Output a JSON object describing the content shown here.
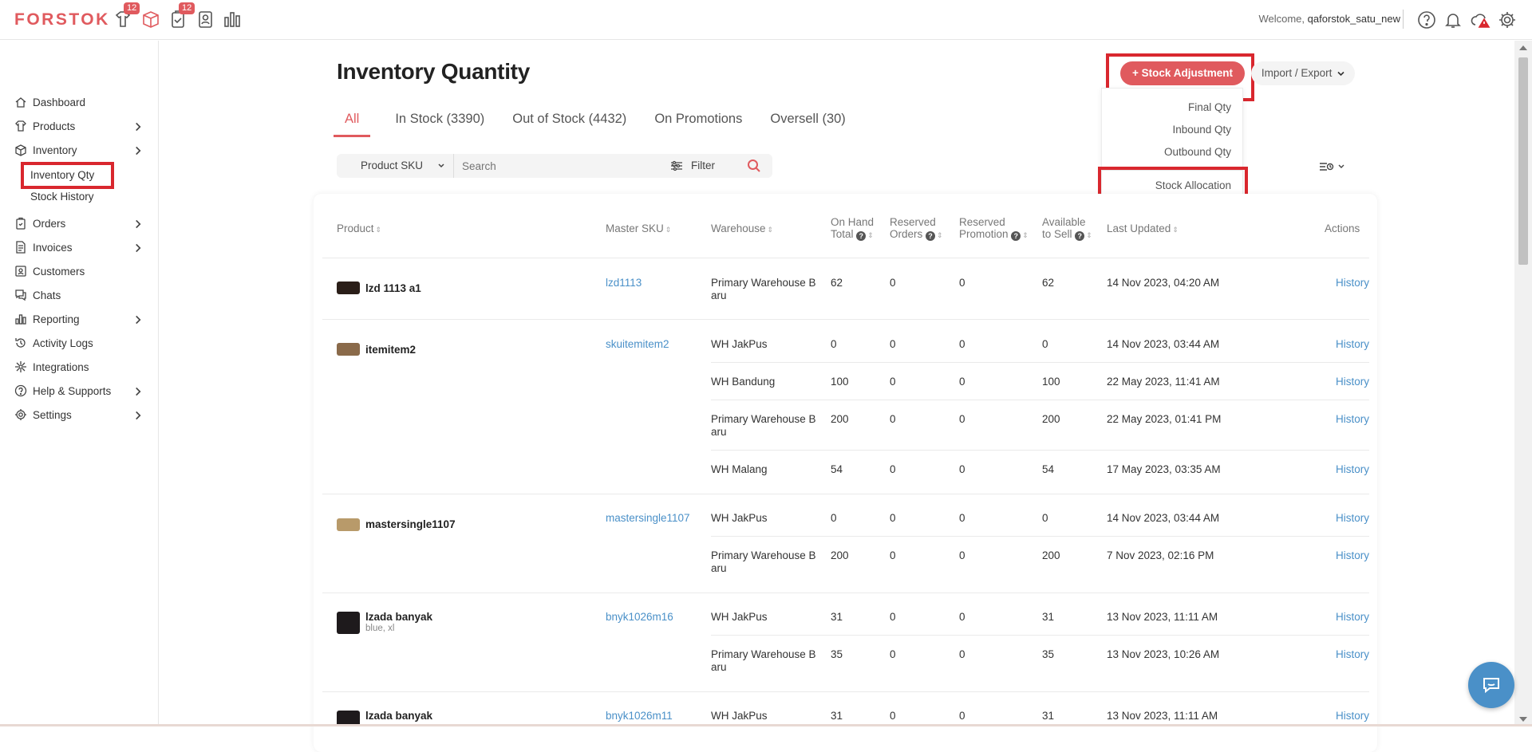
{
  "header": {
    "logo": "FORSTOK",
    "badges": [
      "12",
      "12"
    ],
    "welcome_prefix": "Welcome,",
    "username": "qaforstok_satu_new"
  },
  "sidebar": {
    "items": [
      {
        "label": "Dashboard",
        "icon": "home-icon",
        "has_children": false
      },
      {
        "label": "Products",
        "icon": "tshirt-icon",
        "has_children": true
      },
      {
        "label": "Inventory",
        "icon": "box-icon",
        "has_children": true
      },
      {
        "label": "Orders",
        "icon": "clipboard-icon",
        "has_children": true
      },
      {
        "label": "Invoices",
        "icon": "invoice-icon",
        "has_children": true
      },
      {
        "label": "Customers",
        "icon": "contact-icon",
        "has_children": false
      },
      {
        "label": "Chats",
        "icon": "chat-icon",
        "has_children": false
      },
      {
        "label": "Reporting",
        "icon": "bar-chart-icon",
        "has_children": true
      },
      {
        "label": "Activity Logs",
        "icon": "history-icon",
        "has_children": false
      },
      {
        "label": "Integrations",
        "icon": "integration-icon",
        "has_children": false
      },
      {
        "label": "Help & Supports",
        "icon": "help-icon",
        "has_children": true
      },
      {
        "label": "Settings",
        "icon": "gear-icon",
        "has_children": true
      }
    ],
    "inventory_sub": [
      "Inventory Qty",
      "Stock History"
    ]
  },
  "page": {
    "title": "Inventory Quantity",
    "stock_adjustment_label": "+ Stock Adjustment",
    "import_export_label": "Import / Export",
    "dropdown": [
      "Final Qty",
      "Inbound Qty",
      "Outbound Qty",
      "Stock Allocation"
    ],
    "tabs": [
      "All",
      "In Stock (3390)",
      "Out of Stock (4432)",
      "On Promotions",
      "Oversell (30)"
    ],
    "sku_select": "Product SKU",
    "search_placeholder": "Search",
    "filter_label": "Filter"
  },
  "table": {
    "headers": {
      "product": "Product",
      "master_sku": "Master SKU",
      "warehouse": "Warehouse",
      "on_hand_1": "On Hand",
      "on_hand_2": "Total",
      "reserved_orders_1": "Reserved",
      "reserved_orders_2": "Orders",
      "reserved_promo_1": "Reserved",
      "reserved_promo_2": "Promotion",
      "available_1": "Available",
      "available_2": "to Sell",
      "last_updated": "Last Updated",
      "actions": "Actions"
    },
    "products": [
      {
        "name": "lzd 1113 a1",
        "variant": "",
        "sku": "lzd1113",
        "rows": [
          {
            "wh1": "Primary Warehouse B",
            "wh2": "aru",
            "on_hand": "62",
            "res_orders": "0",
            "res_promo": "0",
            "available": "62",
            "updated": "14 Nov 2023, 04:20 AM",
            "action": "History"
          }
        ]
      },
      {
        "name": "itemitem2",
        "variant": "",
        "sku": "skuitemitem2",
        "rows": [
          {
            "wh1": "WH JakPus",
            "wh2": "",
            "on_hand": "0",
            "res_orders": "0",
            "res_promo": "0",
            "available": "0",
            "updated": "14 Nov 2023, 03:44 AM",
            "action": "History"
          },
          {
            "wh1": "WH Bandung",
            "wh2": "",
            "on_hand": "100",
            "res_orders": "0",
            "res_promo": "0",
            "available": "100",
            "updated": "22 May 2023, 11:41 AM",
            "action": "History"
          },
          {
            "wh1": "Primary Warehouse B",
            "wh2": "aru",
            "on_hand": "200",
            "res_orders": "0",
            "res_promo": "0",
            "available": "200",
            "updated": "22 May 2023, 01:41 PM",
            "action": "History"
          },
          {
            "wh1": "WH Malang",
            "wh2": "",
            "on_hand": "54",
            "res_orders": "0",
            "res_promo": "0",
            "available": "54",
            "updated": "17 May 2023, 03:35 AM",
            "action": "History"
          }
        ]
      },
      {
        "name": "mastersingle1107",
        "variant": "",
        "sku": "mastersingle1107",
        "rows": [
          {
            "wh1": "WH JakPus",
            "wh2": "",
            "on_hand": "0",
            "res_orders": "0",
            "res_promo": "0",
            "available": "0",
            "updated": "14 Nov 2023, 03:44 AM",
            "action": "History"
          },
          {
            "wh1": "Primary Warehouse B",
            "wh2": "aru",
            "on_hand": "200",
            "res_orders": "0",
            "res_promo": "0",
            "available": "200",
            "updated": "7 Nov 2023, 02:16 PM",
            "action": "History"
          }
        ]
      },
      {
        "name": "lzada banyak",
        "variant": "blue, xl",
        "sku": "bnyk1026m16",
        "rows": [
          {
            "wh1": "WH JakPus",
            "wh2": "",
            "on_hand": "31",
            "res_orders": "0",
            "res_promo": "0",
            "available": "31",
            "updated": "13 Nov 2023, 11:11 AM",
            "action": "History"
          },
          {
            "wh1": "Primary Warehouse B",
            "wh2": "aru",
            "on_hand": "35",
            "res_orders": "0",
            "res_promo": "0",
            "available": "35",
            "updated": "13 Nov 2023, 10:26 AM",
            "action": "History"
          }
        ]
      },
      {
        "name": "lzada banyak",
        "variant": "",
        "sku": "bnyk1026m11",
        "rows": [
          {
            "wh1": "WH JakPus",
            "wh2": "",
            "on_hand": "31",
            "res_orders": "0",
            "res_promo": "0",
            "available": "31",
            "updated": "13 Nov 2023, 11:11 AM",
            "action": "History"
          }
        ]
      }
    ]
  },
  "colors": {
    "brand": "#e05a5e",
    "link": "#4a90c8",
    "highlight_box": "#d9272e"
  }
}
